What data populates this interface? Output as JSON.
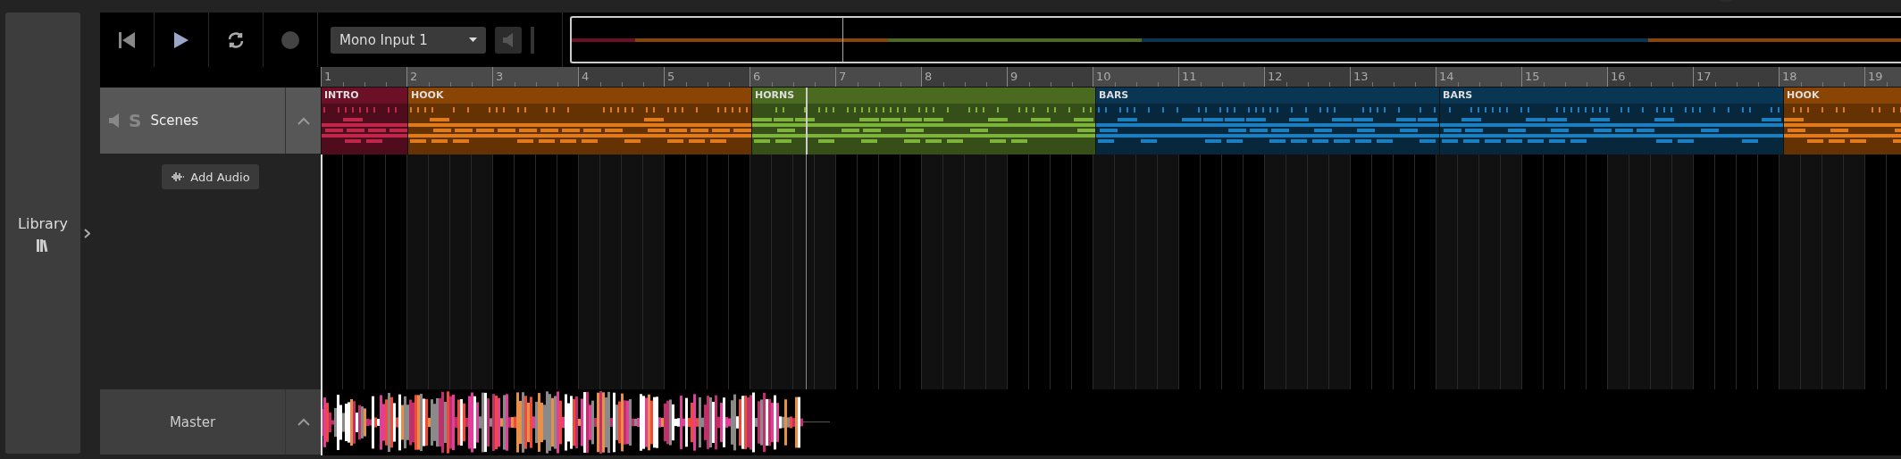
{
  "sidebar": {
    "label": "Library"
  },
  "transport": {
    "playing": false,
    "looping": false,
    "recording": false
  },
  "input": {
    "value": "Mono Input 1",
    "monitor": false
  },
  "ruler": [
    "1",
    "2",
    "3",
    "4",
    "5",
    "6",
    "7",
    "8",
    "9",
    "10",
    "11",
    "12",
    "13",
    "14",
    "15",
    "16",
    "17",
    "18",
    "19"
  ],
  "scenes_track": {
    "solo_label": "S",
    "name": "Scenes",
    "expanded": true
  },
  "scenes": [
    {
      "label": "INTRO",
      "color": "#6b1026"
    },
    {
      "label": "HOOK",
      "color": "#8a4404"
    },
    {
      "label": "HORNS",
      "color": "#4a6a20"
    },
    {
      "label": "BARS",
      "color": "#093652"
    },
    {
      "label": "BARS",
      "color": "#093652"
    },
    {
      "label": "HOOK",
      "color": "#8a4404"
    }
  ],
  "add_audio": {
    "label": "Add Audio"
  },
  "master_track": {
    "name": "Master",
    "expanded": true
  }
}
